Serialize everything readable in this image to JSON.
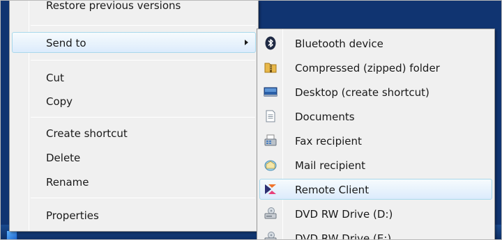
{
  "context_menu": {
    "items": [
      {
        "label": "Restore previous versions"
      },
      {
        "label": "Send to"
      },
      {
        "label": "Cut"
      },
      {
        "label": "Copy"
      },
      {
        "label": "Create shortcut"
      },
      {
        "label": "Delete"
      },
      {
        "label": "Rename"
      },
      {
        "label": "Properties"
      }
    ]
  },
  "send_to_menu": {
    "items": [
      {
        "label": "Bluetooth device",
        "icon": "bluetooth-icon"
      },
      {
        "label": "Compressed (zipped) folder",
        "icon": "zip-folder-icon"
      },
      {
        "label": "Desktop (create shortcut)",
        "icon": "desktop-icon"
      },
      {
        "label": "Documents",
        "icon": "documents-icon"
      },
      {
        "label": "Fax recipient",
        "icon": "fax-icon"
      },
      {
        "label": "Mail recipient",
        "icon": "mail-icon"
      },
      {
        "label": "Remote Client",
        "icon": "remote-client-icon"
      },
      {
        "label": "DVD RW Drive (D:)",
        "icon": "dvd-drive-icon"
      },
      {
        "label": "DVD RW Drive (E:)",
        "icon": "dvd-drive-icon"
      }
    ]
  },
  "colors": {
    "desktop": "#103471",
    "menu_background": "#f0f0f0",
    "highlight_border": "#a8d8eb",
    "highlight_fill": "#dcebfc"
  }
}
